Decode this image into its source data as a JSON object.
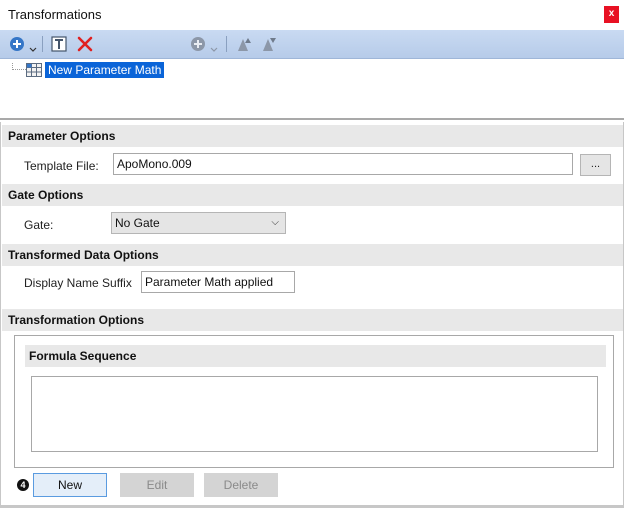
{
  "window": {
    "title": "Transformations",
    "close_label": "x"
  },
  "toolbar": {
    "add_icon": "add-circle-icon",
    "dropdown_icon": "chevron-down-icon",
    "rename_icon": "rename-text-icon",
    "delete_icon": "delete-x-icon",
    "add_formula_icon": "add-circle-icon",
    "move_up_icon": "move-up-icon",
    "move_down_icon": "move-down-icon",
    "accent_color": "#3576c7",
    "delete_color": "#e02020"
  },
  "tree": {
    "items": [
      {
        "label": "New Parameter Math",
        "icon": "parameter-math-icon",
        "selected": true
      }
    ]
  },
  "parameter_options": {
    "header": "Parameter Options",
    "template_label": "Template File:",
    "template_value": "ApoMono.009",
    "browse_label": "..."
  },
  "gate_options": {
    "header": "Gate Options",
    "gate_label": "Gate:",
    "gate_value": "No Gate"
  },
  "transformed_data_options": {
    "header": "Transformed Data Options",
    "suffix_label": "Display Name Suffix",
    "suffix_value": "Parameter Math applied"
  },
  "transformation_options": {
    "header": "Transformation Options",
    "formula_header": "Formula Sequence"
  },
  "actions": {
    "step_badge": "4",
    "new_label": "New",
    "edit_label": "Edit",
    "delete_label": "Delete"
  }
}
